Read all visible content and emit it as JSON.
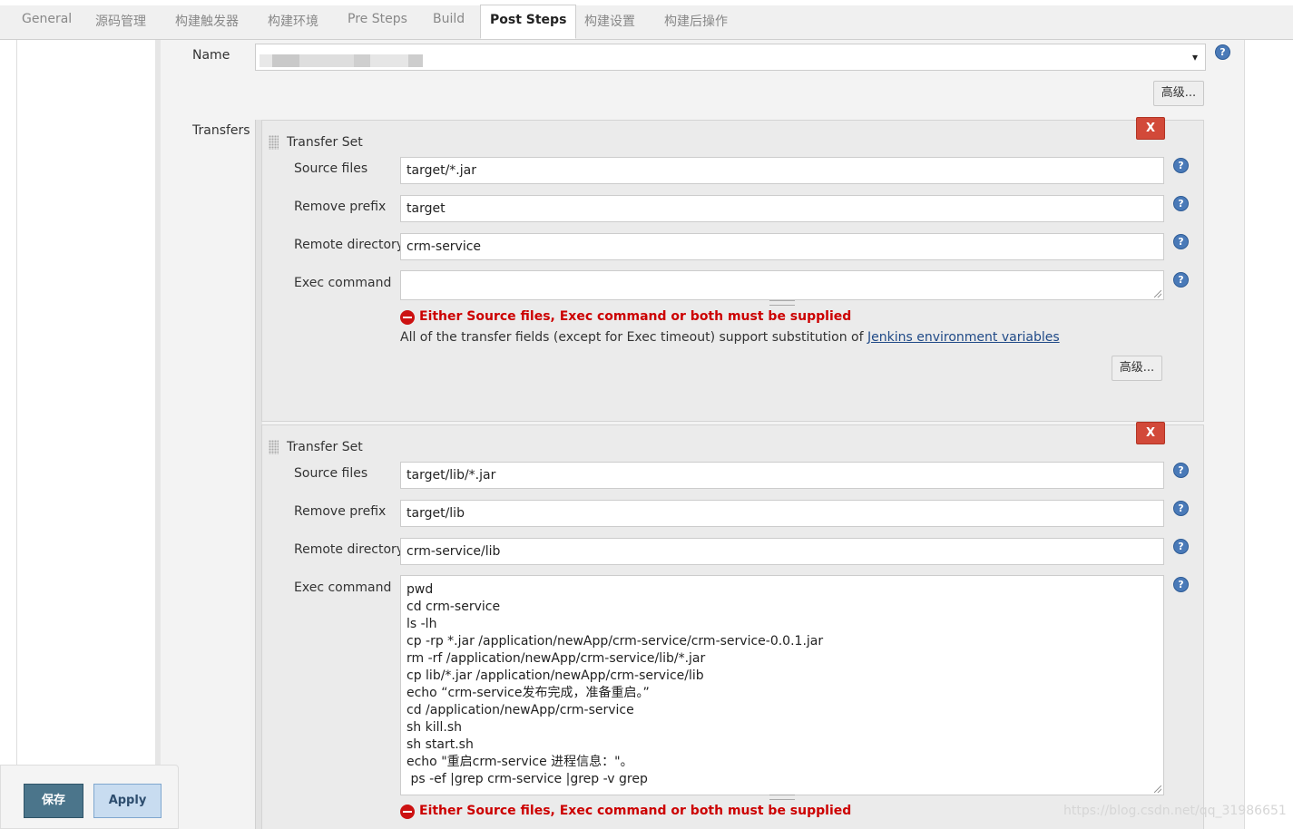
{
  "tabs": [
    "General",
    "源码管理",
    "构建触发器",
    "构建环境",
    "Pre Steps",
    "Build",
    "Post Steps",
    "构建设置",
    "构建后操作"
  ],
  "active_tab": "Post Steps",
  "name_label": "Name",
  "advanced_label": "高级...",
  "transfers_label": "Transfers",
  "help_glyph": "?",
  "delete_glyph": "X",
  "dropdown_arrow": "▾",
  "transfer_sets": [
    {
      "title": "Transfer Set",
      "source_files_label": "Source files",
      "source_files": "target/*.jar",
      "remove_prefix_label": "Remove prefix",
      "remove_prefix": "target",
      "remote_directory_label": "Remote directory",
      "remote_directory": "crm-service",
      "exec_command_label": "Exec command",
      "exec_command": [],
      "error": "Either Source files, Exec command or both must be supplied",
      "info_text": "All of the transfer fields (except for Exec timeout) support substitution of ",
      "info_link": "Jenkins environment variables",
      "advanced_label": "高级..."
    },
    {
      "title": "Transfer Set",
      "source_files_label": "Source files",
      "source_files": "target/lib/*.jar",
      "remove_prefix_label": "Remove prefix",
      "remove_prefix": "target/lib",
      "remote_directory_label": "Remote directory",
      "remote_directory": "crm-service/lib",
      "exec_command_label": "Exec command",
      "exec_command": [
        "pwd",
        "cd crm-service",
        "ls -lh",
        "cp -rp *.jar /application/newApp/crm-service/crm-service-0.0.1.jar",
        "rm -rf /application/newApp/crm-service/lib/*.jar",
        "cp lib/*.jar /application/newApp/crm-service/lib",
        "echo “crm-service发布完成，准备重启。”",
        "cd /application/newApp/crm-service",
        "sh kill.sh",
        "sh start.sh",
        "echo \"重启crm-service 进程信息：\"。",
        " ps -ef |grep crm-service |grep -v grep"
      ],
      "error": "Either Source files, Exec command or both must be supplied"
    }
  ],
  "footer": {
    "save_label": "保存",
    "apply_label": "Apply"
  },
  "watermark": "https://blog.csdn.net/qq_31986651",
  "colors": {
    "error_red": "#cc0000",
    "delete_red": "#d24939",
    "save_blue": "#4b758b",
    "apply_blue": "#c8dcf0",
    "link_blue": "#204a87",
    "help_blue": "#4a7ab8"
  }
}
